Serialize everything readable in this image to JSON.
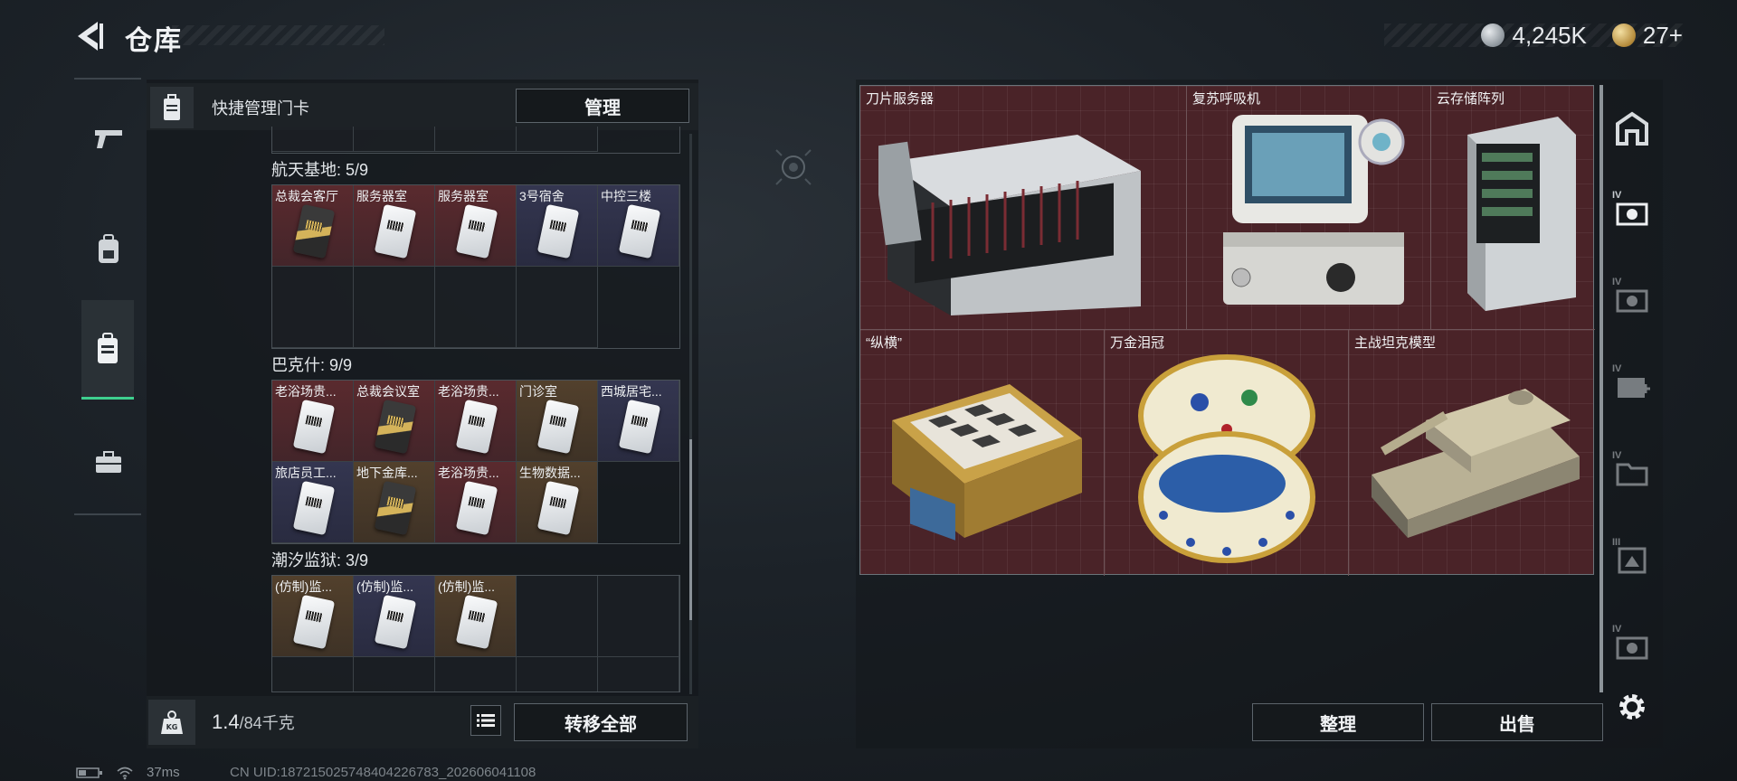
{
  "header": {
    "title": "仓库",
    "currency": [
      {
        "icon": "silver-coin-icon",
        "value": "4,245K"
      },
      {
        "icon": "gold-coin-icon",
        "value": "27+"
      }
    ]
  },
  "left_nav": {
    "items": [
      {
        "icon": "gun-icon",
        "active": false
      },
      {
        "icon": "backpack-icon",
        "active": false
      },
      {
        "icon": "keycard-case-icon",
        "active": true
      },
      {
        "icon": "briefcase-icon",
        "active": false
      }
    ]
  },
  "keycard_panel": {
    "header_label": "快捷管理门卡",
    "manage_label": "管理",
    "groups": [
      {
        "title": "航天基地: 5/9",
        "cards": [
          "总裁会客厅",
          "服务器室",
          "服务器室",
          "3号宿舍",
          "中控三楼"
        ]
      },
      {
        "title": "巴克什: 9/9",
        "cards": [
          "老浴场贵...",
          "总裁会议室",
          "老浴场贵...",
          "门诊室",
          "西城居宅...",
          "旅店员工...",
          "地下金库...",
          "老浴场贵...",
          "生物数据..."
        ]
      },
      {
        "title": "潮汐监狱: 3/9",
        "cards": [
          "(仿制)监...",
          "(仿制)监...",
          "(仿制)监..."
        ]
      }
    ],
    "weight_current": "1.4",
    "weight_max": "/84千克",
    "transfer_all_label": "转移全部"
  },
  "stash": {
    "items": [
      {
        "name": "刀片服务器",
        "rarity_color": "#4a2328"
      },
      {
        "name": "复苏呼吸机",
        "rarity_color": "#4a2328"
      },
      {
        "name": "云存储阵列",
        "rarity_color": "#4a2328"
      },
      {
        "name": "“纵横”",
        "rarity_color": "#4a2328"
      },
      {
        "name": "万金泪冠",
        "rarity_color": "#4a2328"
      },
      {
        "name": "主战坦克模型",
        "rarity_color": "#4a2328"
      }
    ],
    "sort_label": "整理",
    "sell_label": "出售"
  },
  "right_nav": {
    "items": [
      {
        "icon": "stash-icon",
        "tier": ""
      },
      {
        "icon": "tier4-case-icon",
        "tier": "IV"
      },
      {
        "icon": "tier4-case-icon",
        "tier": "IV"
      },
      {
        "icon": "tier4-medical-icon",
        "tier": "IV"
      },
      {
        "icon": "tier4-folder-icon",
        "tier": "IV"
      },
      {
        "icon": "tier3-box-icon",
        "tier": "III"
      },
      {
        "icon": "tier4-case-icon",
        "tier": "IV"
      },
      {
        "icon": "settings-gear-icon",
        "tier": ""
      }
    ]
  },
  "status_bar": {
    "ping": "37ms",
    "uid": "CN UID:187215025748404226783_202606041108"
  }
}
